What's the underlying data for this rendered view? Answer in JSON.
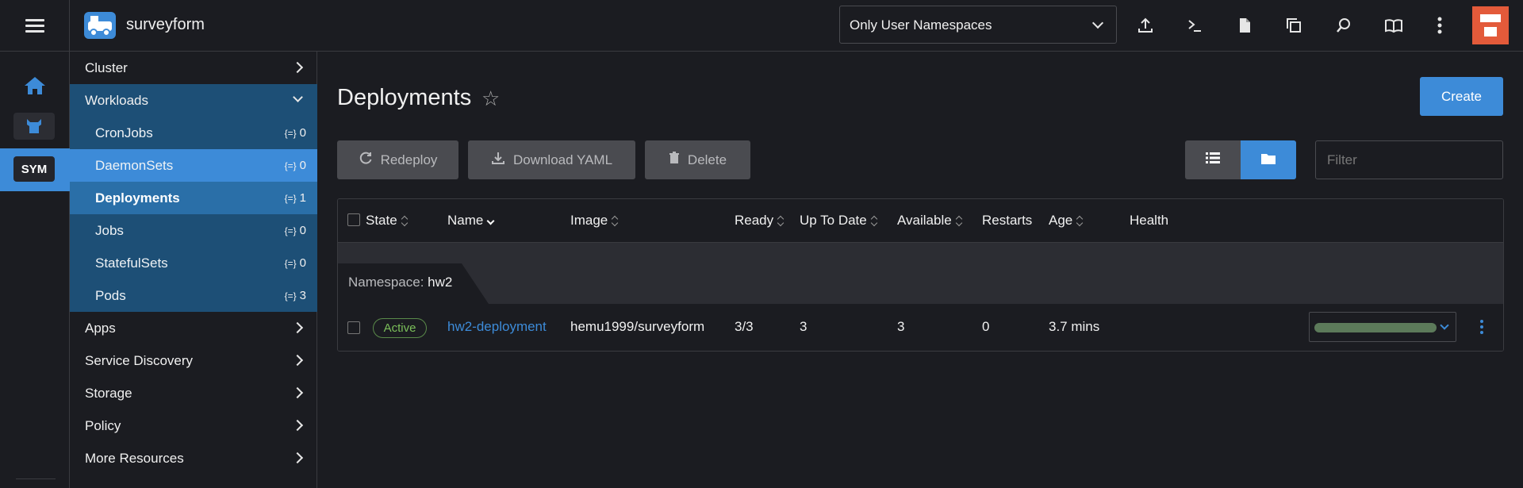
{
  "app": {
    "name": "surveyform"
  },
  "topbar": {
    "namespace_select": "Only User Namespaces",
    "icons": [
      "menu-icon",
      "upload-icon",
      "terminal-icon",
      "file-icon",
      "copy-config-icon",
      "search-icon",
      "docs-icon",
      "more-vertical-icon"
    ]
  },
  "rail": {
    "cluster_label": "SYM"
  },
  "sidenav": {
    "groups": {
      "cluster": "Cluster",
      "workloads": "Workloads",
      "apps": "Apps",
      "service_discovery": "Service Discovery",
      "storage": "Storage",
      "policy": "Policy",
      "more_resources": "More Resources"
    },
    "workloads_items": [
      {
        "label": "CronJobs",
        "count": "0"
      },
      {
        "label": "DaemonSets",
        "count": "0"
      },
      {
        "label": "Deployments",
        "count": "1"
      },
      {
        "label": "Jobs",
        "count": "0"
      },
      {
        "label": "StatefulSets",
        "count": "0"
      },
      {
        "label": "Pods",
        "count": "3"
      }
    ]
  },
  "main": {
    "title": "Deployments",
    "create_label": "Create",
    "actions": {
      "redeploy": "Redeploy",
      "download_yaml": "Download YAML",
      "delete": "Delete"
    },
    "filter_placeholder": "Filter",
    "table": {
      "headers": {
        "state": "State",
        "name": "Name",
        "image": "Image",
        "ready": "Ready",
        "uptodate": "Up To Date",
        "available": "Available",
        "restarts": "Restarts",
        "age": "Age",
        "health": "Health"
      },
      "group": {
        "prefix": "Namespace:",
        "value": "hw2"
      },
      "rows": [
        {
          "state": "Active",
          "name": "hw2-deployment",
          "image": "hemu1999/surveyform",
          "ready": "3/3",
          "uptodate": "3",
          "available": "3",
          "restarts": "0",
          "age": "3.7 mins"
        }
      ]
    }
  },
  "colors": {
    "accent": "#3d8bd8",
    "active_badge": "#7bbf5a",
    "nav_open": "#1d4f76",
    "health_bar": "#5c7a5a"
  }
}
